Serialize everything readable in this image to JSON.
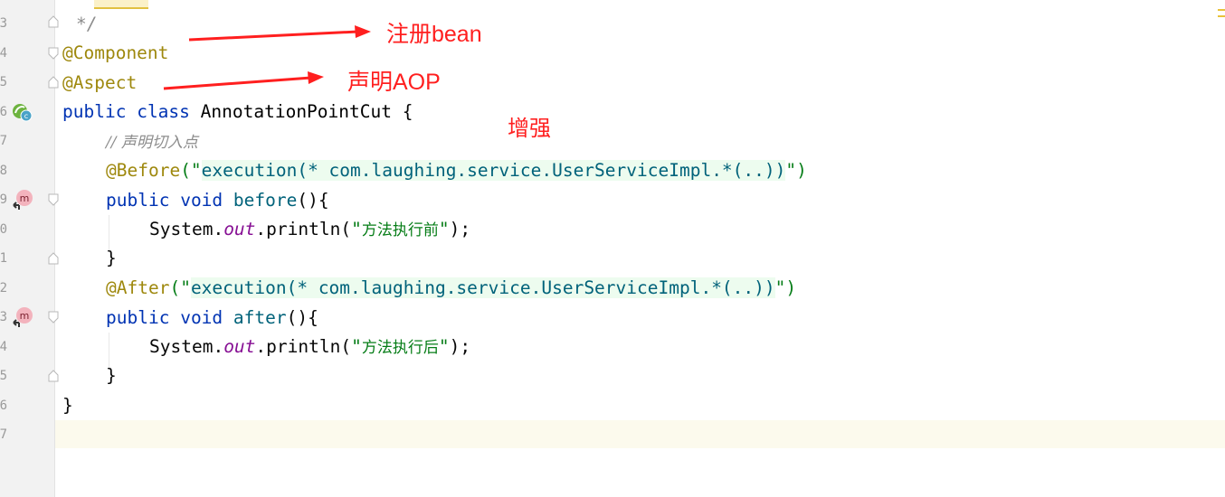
{
  "line_numbers": [
    "3",
    "4",
    "5",
    "6",
    "7",
    "8",
    "9",
    "0",
    "1",
    "2",
    "3",
    "4",
    "5",
    "6",
    "7"
  ],
  "code": {
    "comment_end": "*/",
    "l_component": "@Component",
    "l_aspect": "@Aspect",
    "l_class": {
      "kw1": "public",
      "kw2": "class",
      "name": "AnnotationPointCut",
      "brace": " {"
    },
    "l_comment": "// 声明切入点",
    "l_before": {
      "ann": "@Before",
      "open": "(\"",
      "inject": "execution(* com.laughing.service.UserServiceImpl.*(..))",
      "close": "\")"
    },
    "l_before_method": {
      "kw1": "public",
      "kw2": "void",
      "name": "before",
      "rest": "(){"
    },
    "l_print1": {
      "obj": "System.",
      "field": "out",
      "call": ".println(",
      "q1": "\"",
      "text": "方法执行前",
      "q2": "\"",
      "end": ");"
    },
    "l_close1": "}",
    "l_after": {
      "ann": "@After",
      "open": "(\"",
      "inject": "execution(* com.laughing.service.UserServiceImpl.*(..))",
      "close": "\")"
    },
    "l_after_method": {
      "kw1": "public",
      "kw2": "void",
      "name": "after",
      "rest": "(){"
    },
    "l_print2": {
      "obj": "System.",
      "field": "out",
      "call": ".println(",
      "q1": "\"",
      "text": "方法执行后",
      "q2": "\"",
      "end": ");"
    },
    "l_close2": "}",
    "l_close_class": "}"
  },
  "annotations": {
    "register_bean": "注册bean",
    "declare_aop": "声明AOP",
    "enhance": "增强"
  },
  "colors": {
    "annotation_label": "#ff1f1f",
    "keyword": "#0033b3",
    "string": "#067d17",
    "annotation": "#9e880d"
  },
  "icons": {
    "class_gutter": "spring-bean-class-icon",
    "method_gutter": "advice-method-icon"
  }
}
